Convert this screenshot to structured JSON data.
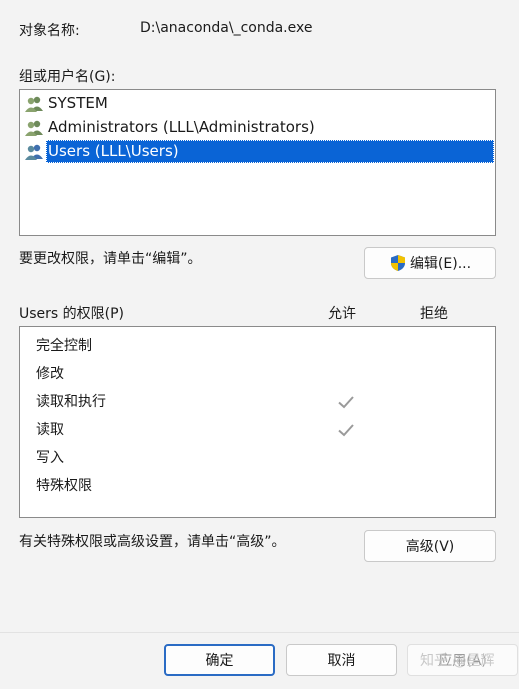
{
  "object": {
    "label": "对象名称:",
    "value": "D:\\anaconda\\_conda.exe"
  },
  "groups": {
    "label": "组或用户名(G):",
    "items": [
      {
        "name": "SYSTEM",
        "selected": false
      },
      {
        "name": "Administrators (LLL\\Administrators)",
        "selected": false
      },
      {
        "name": "Users (LLL\\Users)",
        "selected": true
      }
    ]
  },
  "edit": {
    "note": "要更改权限，请单击“编辑”。",
    "button_label": "编辑(E)..."
  },
  "permissions": {
    "header": "Users 的权限(P)",
    "allow_label": "允许",
    "deny_label": "拒绝",
    "rows": [
      {
        "name": "完全控制",
        "allow": false,
        "deny": false
      },
      {
        "name": "修改",
        "allow": false,
        "deny": false
      },
      {
        "name": "读取和执行",
        "allow": true,
        "deny": false
      },
      {
        "name": "读取",
        "allow": true,
        "deny": false
      },
      {
        "name": "写入",
        "allow": false,
        "deny": false
      },
      {
        "name": "特殊权限",
        "allow": false,
        "deny": false
      }
    ]
  },
  "advanced": {
    "note": "有关特殊权限或高级设置，请单击“高级”。",
    "button_label": "高级(V)"
  },
  "footer": {
    "ok": "确定",
    "cancel": "取消",
    "apply": "应用(A)"
  },
  "watermark": "知乎 @星辉",
  "colors": {
    "selection": "#0a64d6",
    "ok_border": "#2a6bc4",
    "check": "#9a9a9a"
  }
}
